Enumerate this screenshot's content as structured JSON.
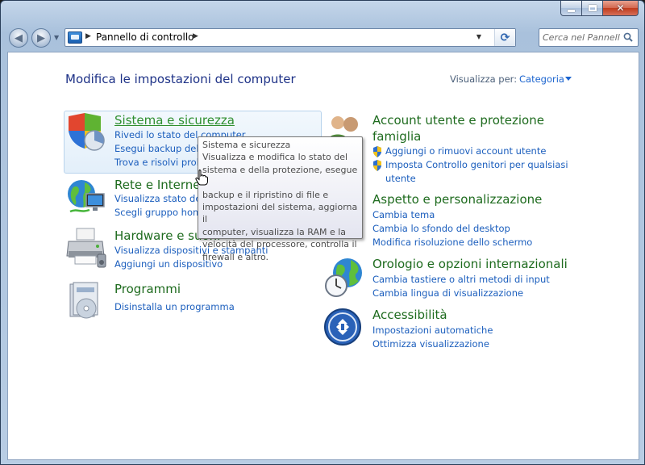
{
  "window": {
    "caption_buttons": {
      "minimize_icon": "minimize-icon",
      "maximize_icon": "maximize-icon",
      "close_icon": "close-icon",
      "close_glyph": "✕"
    }
  },
  "navbar": {
    "back_glyph": "◀",
    "forward_glyph": "▶",
    "address": {
      "path": "Pannello di controllo",
      "refresh_icon": "refresh-icon"
    },
    "search": {
      "placeholder": "Cerca nel Pannello di controllo"
    }
  },
  "content": {
    "title": "Modifica le impostazioni del computer",
    "view_by_label": "Visualizza per:",
    "view_by_value": "Categoria"
  },
  "left_categories": [
    {
      "title": "Sistema e sicurezza",
      "icon": "shield-security-icon",
      "links": [
        "Rivedi lo stato del computer",
        "Esegui backup del computer",
        "Trova e risolvi problemi"
      ]
    },
    {
      "title": "Rete e Internet",
      "icon": "globe-network-icon",
      "links": [
        "Visualizza stato della rete e attività",
        "Scegli gruppo home e opzioni di condivisione"
      ]
    },
    {
      "title": "Hardware e suoni",
      "icon": "printer-icon",
      "links": [
        "Visualizza dispositivi e stampanti",
        "Aggiungi un dispositivo"
      ]
    },
    {
      "title": "Programmi",
      "icon": "programs-icon",
      "links": [
        "Disinstalla un programma"
      ]
    }
  ],
  "right_categories": [
    {
      "title_line1": "Account utente e protezione",
      "title_line2": "famiglia",
      "icon": "users-icon",
      "links": [
        "Aggiungi o rimuovi account utente",
        "Imposta Controllo genitori per qualsiasi",
        "utente"
      ]
    },
    {
      "title": "Aspetto e personalizzazione",
      "icon": "appearance-icon",
      "links": [
        "Cambia tema",
        "Cambia lo sfondo del desktop",
        "Modifica risoluzione dello schermo"
      ]
    },
    {
      "title": "Orologio e opzioni internazionali",
      "icon": "clock-globe-icon",
      "links": [
        "Cambia tastiere o altri metodi di input",
        "Cambia lingua di visualizzazione"
      ]
    },
    {
      "title": "Accessibilità",
      "icon": "accessibility-icon",
      "links": [
        "Impostazioni automatiche",
        "Ottimizza visualizzazione"
      ]
    }
  ],
  "tooltip": {
    "title": "Sistema e sicurezza",
    "lines": [
      "Visualizza e modifica lo stato del",
      "sistema e della protezione, esegue il",
      "backup e il ripristino di file e",
      "impostazioni del sistema, aggiorna il",
      "computer, visualizza la RAM e la",
      "velocità del processore, controlla il",
      "firewall e altro."
    ]
  },
  "colors": {
    "category_title": "#1e6b1e",
    "link": "#1b5ebd",
    "page_title": "#1e3287"
  }
}
